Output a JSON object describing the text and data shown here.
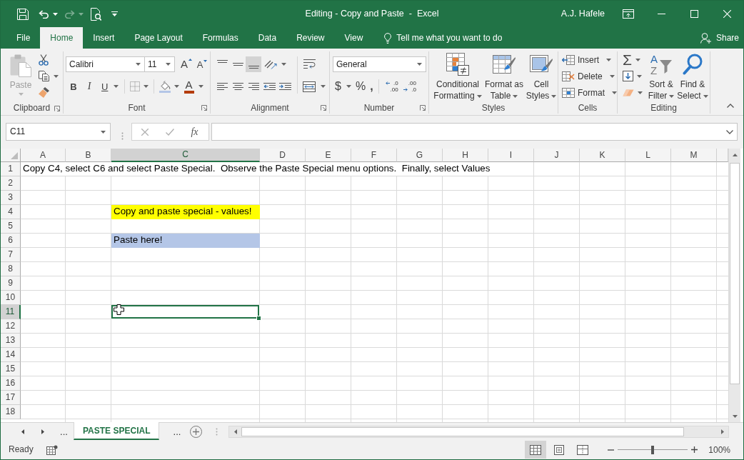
{
  "window": {
    "title": "Editing - Copy and Paste  -  Excel",
    "user": "A.J. Hafele"
  },
  "quick_access": [
    {
      "kind": "save",
      "disabled": false
    },
    {
      "kind": "undo",
      "disabled": false
    },
    {
      "kind": "redo",
      "disabled": true
    },
    {
      "kind": "print-preview",
      "disabled": false
    },
    {
      "kind": "customize",
      "disabled": false
    }
  ],
  "tabs": [
    {
      "label": "File",
      "selected": false
    },
    {
      "label": "Home",
      "selected": true
    },
    {
      "label": "Insert",
      "selected": false
    },
    {
      "label": "Page Layout",
      "selected": false
    },
    {
      "label": "Formulas",
      "selected": false
    },
    {
      "label": "Data",
      "selected": false
    },
    {
      "label": "Review",
      "selected": false
    },
    {
      "label": "View",
      "selected": false
    }
  ],
  "tell_me": {
    "placeholder": "Tell me what you want to do"
  },
  "share": "Share",
  "ribbon": {
    "clipboard": {
      "title": "Clipboard",
      "paste": {
        "label": "Paste",
        "disabled": true
      }
    },
    "font": {
      "title": "Font",
      "font_name": "Calibri",
      "font_size": "11",
      "grow": "A",
      "shrink": "A",
      "bold": "B",
      "italic": "I",
      "underline": "U",
      "font_color": "A"
    },
    "alignment": {
      "title": "Alignment",
      "vertical": [
        {
          "kind": "top",
          "selected": false
        },
        {
          "kind": "middle",
          "selected": false
        },
        {
          "kind": "bottom",
          "selected": true
        }
      ]
    },
    "number": {
      "title": "Number",
      "format": "General",
      "currency": "$",
      "percent": "%",
      "comma": ",",
      "decimals": [
        {
          "kind": "increase",
          "top": ".0",
          "bottom": ".00"
        },
        {
          "kind": "decrease",
          "top": ".00",
          "bottom": ".0"
        }
      ]
    },
    "styles": {
      "title": "Styles",
      "buttons": [
        {
          "kind": "conditional",
          "label": "Conditional Formatting"
        },
        {
          "kind": "table",
          "label": "Format as Table"
        },
        {
          "kind": "cell",
          "label": "Cell Styles"
        }
      ]
    },
    "cells": {
      "title": "Cells",
      "buttons": [
        {
          "kind": "insert",
          "label": "Insert"
        },
        {
          "kind": "delete",
          "label": "Delete"
        },
        {
          "kind": "format",
          "label": "Format"
        }
      ]
    },
    "editing": {
      "title": "Editing",
      "autosum": "Σ",
      "sort": {
        "label": "Sort & Filter",
        "icon_letters": [
          "A",
          "Z"
        ]
      },
      "find": {
        "label": "Find & Select"
      }
    }
  },
  "formula_bar": {
    "name_box": "C11",
    "function": "fx"
  },
  "sheet": {
    "columns": [
      {
        "label": "A",
        "selected": false
      },
      {
        "label": "B",
        "selected": false
      },
      {
        "label": "C",
        "selected": true
      },
      {
        "label": "D",
        "selected": false
      },
      {
        "label": "E",
        "selected": false
      },
      {
        "label": "F",
        "selected": false
      },
      {
        "label": "G",
        "selected": false
      },
      {
        "label": "H",
        "selected": false
      },
      {
        "label": "I",
        "selected": false
      },
      {
        "label": "J",
        "selected": false
      },
      {
        "label": "K",
        "selected": false
      },
      {
        "label": "L",
        "selected": false
      },
      {
        "label": "M",
        "selected": false
      }
    ],
    "rows": [
      {
        "label": "1",
        "selected": false,
        "cells": [
          {
            "text": "Copy C4, select C6 and select Paste Special.  Observe the Paste Special menu options.  Finally, select Values"
          }
        ]
      },
      {
        "label": "2",
        "selected": false
      },
      {
        "label": "3",
        "selected": false
      },
      {
        "label": "4",
        "selected": false,
        "cells": [
          null,
          null,
          {
            "text": "Copy and paste special - values!",
            "color": "#ffff00"
          }
        ]
      },
      {
        "label": "5",
        "selected": false
      },
      {
        "label": "6",
        "selected": false,
        "cells": [
          null,
          null,
          {
            "text": "Paste here!",
            "color": "#b4c6e7"
          }
        ]
      },
      {
        "label": "7",
        "selected": false
      },
      {
        "label": "8",
        "selected": false
      },
      {
        "label": "9",
        "selected": false
      },
      {
        "label": "10",
        "selected": false
      },
      {
        "label": "11",
        "selected": true
      },
      {
        "label": "12",
        "selected": false
      },
      {
        "label": "13",
        "selected": false
      },
      {
        "label": "14",
        "selected": false
      },
      {
        "label": "15",
        "selected": false
      },
      {
        "label": "16",
        "selected": false
      },
      {
        "label": "17",
        "selected": false
      },
      {
        "label": "18",
        "selected": false
      }
    ]
  },
  "sheet_tabs": {
    "scroll_left": "...",
    "tabs": [
      {
        "label": "PASTE SPECIAL",
        "selected": true
      }
    ],
    "scroll_right": "..."
  },
  "status_bar": {
    "status": "Ready",
    "views": [
      {
        "kind": "normal",
        "selected": true
      },
      {
        "kind": "page-layout",
        "selected": false
      },
      {
        "kind": "page-break",
        "selected": false
      }
    ],
    "zoom": {
      "level": 0.5,
      "reading": "100%"
    }
  }
}
